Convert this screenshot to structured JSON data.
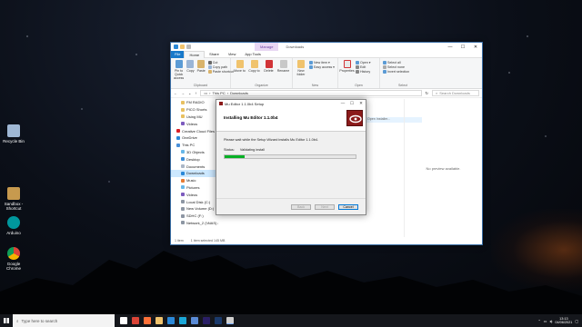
{
  "desktop": {
    "icons": [
      {
        "label": "Recycle Bin",
        "color": "#9fb7d4"
      },
      {
        "label": "Sandbox - Shortcut",
        "color": "#c79a4e"
      },
      {
        "label": "Arduino",
        "color": "#00979d"
      },
      {
        "label": "Google Chrome",
        "color": "#db4437"
      }
    ]
  },
  "explorer": {
    "manage_tab": "Manage",
    "title": "Downloads",
    "controls": {
      "minimize": "—",
      "maximize": "☐",
      "close": "✕"
    },
    "tabs": {
      "file": "File",
      "home": "Home",
      "share": "Share",
      "view": "View",
      "app_tools": "App Tools"
    },
    "ribbon": {
      "pin": "Pin to Quick access",
      "copy": "Copy",
      "paste": "Paste",
      "cut": "Cut",
      "copy_path": "Copy path",
      "paste_shortcut": "Paste shortcut",
      "clipboard": "Clipboard",
      "move_to": "Move to",
      "copy_to": "Copy to",
      "delete": "Delete",
      "rename": "Rename",
      "organize": "Organize",
      "new_folder": "New folder",
      "new_item": "New item ▾",
      "easy_access": "Easy access ▾",
      "new": "New",
      "properties": "Properties",
      "open_menu": "Open ▾",
      "edit": "Edit",
      "history": "History",
      "open_group": "Open",
      "select_all": "Select all",
      "select_none": "Select none",
      "invert_selection": "Invert selection",
      "select_group": "Select"
    },
    "address": {
      "path_1": "This PC",
      "path_2": "Downloads",
      "search_placeholder": "Search Downloads"
    },
    "nav": [
      {
        "label": "FM RADIO",
        "level": 2,
        "color": "#e8c060"
      },
      {
        "label": "PICO Shorts",
        "level": 2,
        "color": "#e8c060"
      },
      {
        "label": "Using MU",
        "level": 2,
        "color": "#e8c060"
      },
      {
        "label": "Videos",
        "level": 2,
        "color": "#7d5bbe"
      },
      {
        "label": "Creative Cloud Files",
        "level": 1,
        "color": "#da1f26"
      },
      {
        "label": "OneDrive",
        "level": 1,
        "color": "#2b88d8"
      },
      {
        "label": "This PC",
        "level": 1,
        "color": "#4a90d9"
      },
      {
        "label": "3D Objects",
        "level": 2,
        "color": "#67b7e8"
      },
      {
        "label": "Desktop",
        "level": 2,
        "color": "#3c8dd8"
      },
      {
        "label": "Documents",
        "level": 2,
        "color": "#aab6c6"
      },
      {
        "label": "Downloads",
        "level": 2,
        "color": "#2b88d8",
        "selected": true
      },
      {
        "label": "Music",
        "level": 2,
        "color": "#e77c34"
      },
      {
        "label": "Pictures",
        "level": 2,
        "color": "#67b7e8"
      },
      {
        "label": "Videos",
        "level": 2,
        "color": "#7d5bbe"
      },
      {
        "label": "Local Disk (C:)",
        "level": 2,
        "color": "#8d96a3"
      },
      {
        "label": "New Volume (D:)",
        "level": 2,
        "color": "#8d96a3"
      },
      {
        "label": "SDHC (F:)",
        "level": 2,
        "color": "#8d96a3"
      },
      {
        "label": "Network_2 (\\\\NAS) (Z:)",
        "level": 2,
        "color": "#8d96a3"
      }
    ],
    "file_header": "Open Installer...",
    "preview_text": "No preview available.",
    "status": {
      "items": "1 item",
      "selected": "1 item selected  145 MB"
    }
  },
  "setup": {
    "title": "Mu Editor 1.1.0b4 Setup",
    "controls": {
      "minimize": "—",
      "maximize": "☐",
      "close": "✕"
    },
    "heading": "Installing Mu Editor 1.1.0b4",
    "message": "Please wait while the Setup Wizard installs Mu Editor 1.1.0b4.",
    "status_label": "Status:",
    "status_value": "Validating install",
    "progress": 0.15,
    "buttons": {
      "back": "Back",
      "next": "Next",
      "cancel": "Cancel"
    }
  },
  "taskbar": {
    "search_placeholder": "Type here to search",
    "apps": [
      {
        "name": "task-view",
        "color": "#ffffff"
      },
      {
        "name": "chrome",
        "color": "#db4437"
      },
      {
        "name": "firefox",
        "color": "#ff7139"
      },
      {
        "name": "file-explorer",
        "color": "#f0c36d"
      },
      {
        "name": "mail",
        "color": "#2b88d8"
      },
      {
        "name": "edge",
        "color": "#1ba7d8"
      },
      {
        "name": "photos",
        "color": "#5a8bd6"
      },
      {
        "name": "premiere",
        "color": "#2a1f66"
      },
      {
        "name": "photoshop",
        "color": "#1b3a6b"
      },
      {
        "name": "setup",
        "color": "#d0d0d0",
        "active": true
      }
    ],
    "time": "13:13",
    "date": "04/06/2021"
  }
}
